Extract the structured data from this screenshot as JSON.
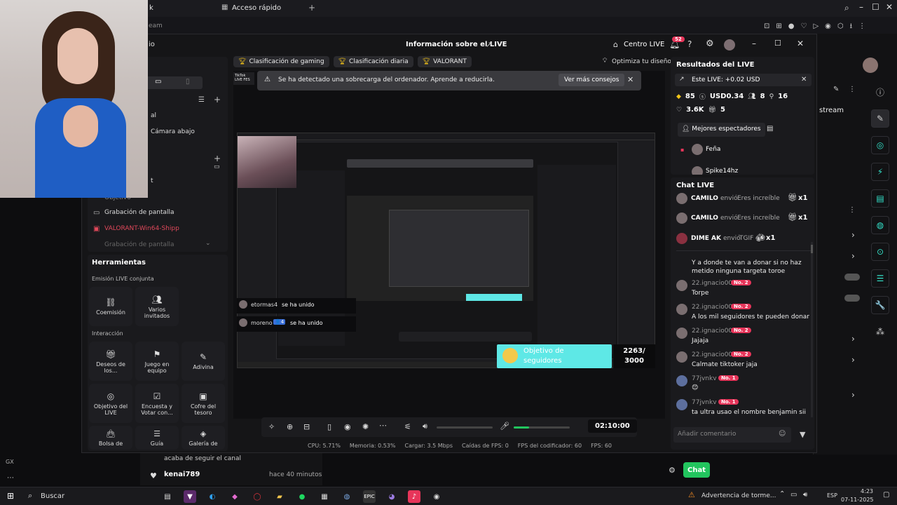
{
  "browser": {
    "tab_fragment": "k",
    "tab_quick_access": "Acceso rápido",
    "stream_fragment": "eam",
    "gx_label": "GX"
  },
  "studio": {
    "title": "Información sobre el LIVE",
    "live_center": "Centro LIVE",
    "notif_count": "52",
    "left_fragment": "io",
    "tags": [
      "Clasificación de gaming",
      "Clasificación diaria",
      "VALORANT"
    ],
    "optimize": "Optimiza tu diseño",
    "alert": {
      "text": "Se ha detectado una sobrecarga del ordenador. Aprende a reducirla.",
      "action": "Ver más consejos"
    },
    "scenes": {
      "fragment1": "al",
      "fragment2": "Cámara abajo",
      "fragment3": "t",
      "objective_fragment": "Objetivo",
      "sources": [
        "Grabación de pantalla",
        "VALORANT-Win64-Shipp",
        "Grabación de pantalla"
      ]
    },
    "tools": {
      "heading": "Herramientas",
      "joint_heading": "Emisión LIVE conjunta",
      "joint": [
        "Coemisión",
        "Varios invitados"
      ],
      "interaction_heading": "Interacción",
      "interaction": [
        "Deseos de los...",
        "Juego en equipo",
        "Adivina",
        "Objetivo del LIVE",
        "Encuesta y Votar con...",
        "Cofre del tesoro",
        "Bolsa de",
        "Guía",
        "Galería de"
      ]
    },
    "overlay": {
      "joins": [
        {
          "user": "etormas4",
          "text": "se ha unido"
        },
        {
          "user": "moreno",
          "text": "se ha unido"
        }
      ],
      "goal_label": "Objetivo de seguidores",
      "goal_value": "2263/ 3000"
    },
    "controls": {
      "timer": "02:10:00"
    },
    "stats": {
      "cpu": "CPU: 5.71%",
      "memory": "Memoria: 0.53%",
      "upload": "Cargar: 3.5 Mbps",
      "fps_drops": "Caídas de FPS: 0",
      "encoder_fps": "FPS del codificador: 60",
      "fps": "FPS: 60"
    },
    "results": {
      "title": "Resultados del LIVE",
      "this_live": "Este LIVE: +0.02 USD",
      "diamonds": "85",
      "usd": "USD0.34",
      "viewers": "8",
      "joined": "16",
      "likes": "3.6K",
      "gifts": "5",
      "top_viewers_btn": "Mejores espectadores",
      "top_viewer": "Feña",
      "top_viewer2": "Spike14hz"
    },
    "chat": {
      "title": "Chat LIVE",
      "gifts": [
        {
          "user": "CAMILO",
          "verb": "envió",
          "gift": "Eres increíble",
          "count": "x1"
        },
        {
          "user": "CAMILO",
          "verb": "envió",
          "gift": "Eres increíble",
          "count": "x1"
        },
        {
          "user": "DIME AK",
          "verb": "envió",
          "gift": "TGIF",
          "count": "x1"
        }
      ],
      "first_msg": "Y a donde te van a donar si no haz metido ninguna targeta toroe",
      "messages": [
        {
          "user": "22.ignacio00",
          "badge": "No. 2",
          "text": "Torpe"
        },
        {
          "user": "22.ignacio00",
          "badge": "No. 2",
          "text": "A los mil seguidores te pueden donar"
        },
        {
          "user": "22.ignacio00",
          "badge": "No. 2",
          "text": "Jajaja"
        },
        {
          "user": "22.ignacio00",
          "badge": "No. 2",
          "text": "Calmate tiktoker jaja"
        },
        {
          "user": "77jvnkv",
          "badge": "No. 1",
          "text": "😊"
        },
        {
          "user": "77jvnkv",
          "badge": "No. 1",
          "text": "ta ultra usao el nombre benjamin sii"
        }
      ],
      "placeholder": "Añadir comentario"
    }
  },
  "background": {
    "follow_text": "acaba de seguir el canal",
    "follower": "kenai789",
    "follower_time": "hace 40 minutos",
    "chat_button": "Chat",
    "stream_fragment": "stream"
  },
  "taskbar": {
    "search": "Buscar",
    "weather": "Advertencia de torme...",
    "lang": "ESP",
    "time": "4:23",
    "date": "07-11-2025"
  }
}
